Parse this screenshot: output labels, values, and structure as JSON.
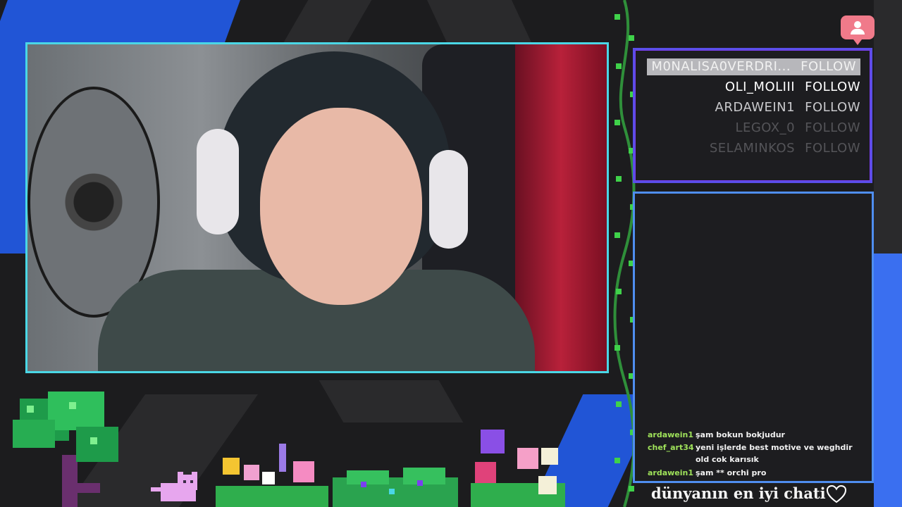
{
  "followers": {
    "rows": [
      {
        "name": "M0NALISA0VERDRI...",
        "action": "FOLLOW",
        "color": "#f1f1f1",
        "highlight": true
      },
      {
        "name": "OLI_MOLIII",
        "action": "FOLLOW",
        "color": "#ffffff",
        "highlight": false
      },
      {
        "name": "ARDAWEIN1",
        "action": "FOLLOW",
        "color": "#c9c9cc",
        "highlight": false
      },
      {
        "name": "LEGOX_0",
        "action": "FOLLOW",
        "color": "#545458",
        "highlight": false
      },
      {
        "name": "SELAMINKOS",
        "action": "FOLLOW",
        "color": "#545458",
        "highlight": false
      }
    ]
  },
  "notification": {
    "icon": "user-icon",
    "color": "#f07a8a"
  },
  "chat": {
    "title": "dünyanın en iyi chati",
    "heart_icon": "heart-outline-icon",
    "messages": [
      {
        "user": "ardawein1",
        "text": "şam bokun bokjudur"
      },
      {
        "user": "chef_art34",
        "text": "yeni işlerde best motive ve weghdir old cok karısık"
      },
      {
        "user": "ardawein1",
        "text": "şam ** orchi pro"
      }
    ],
    "username_color": "#9fe25a"
  },
  "colors": {
    "cam_border": "#4ad7e6",
    "follow_border": "#5a4ee8",
    "chat_border": "#4f8ef0",
    "background": "#1c1c1e",
    "accent_blue": "#2155d6"
  }
}
